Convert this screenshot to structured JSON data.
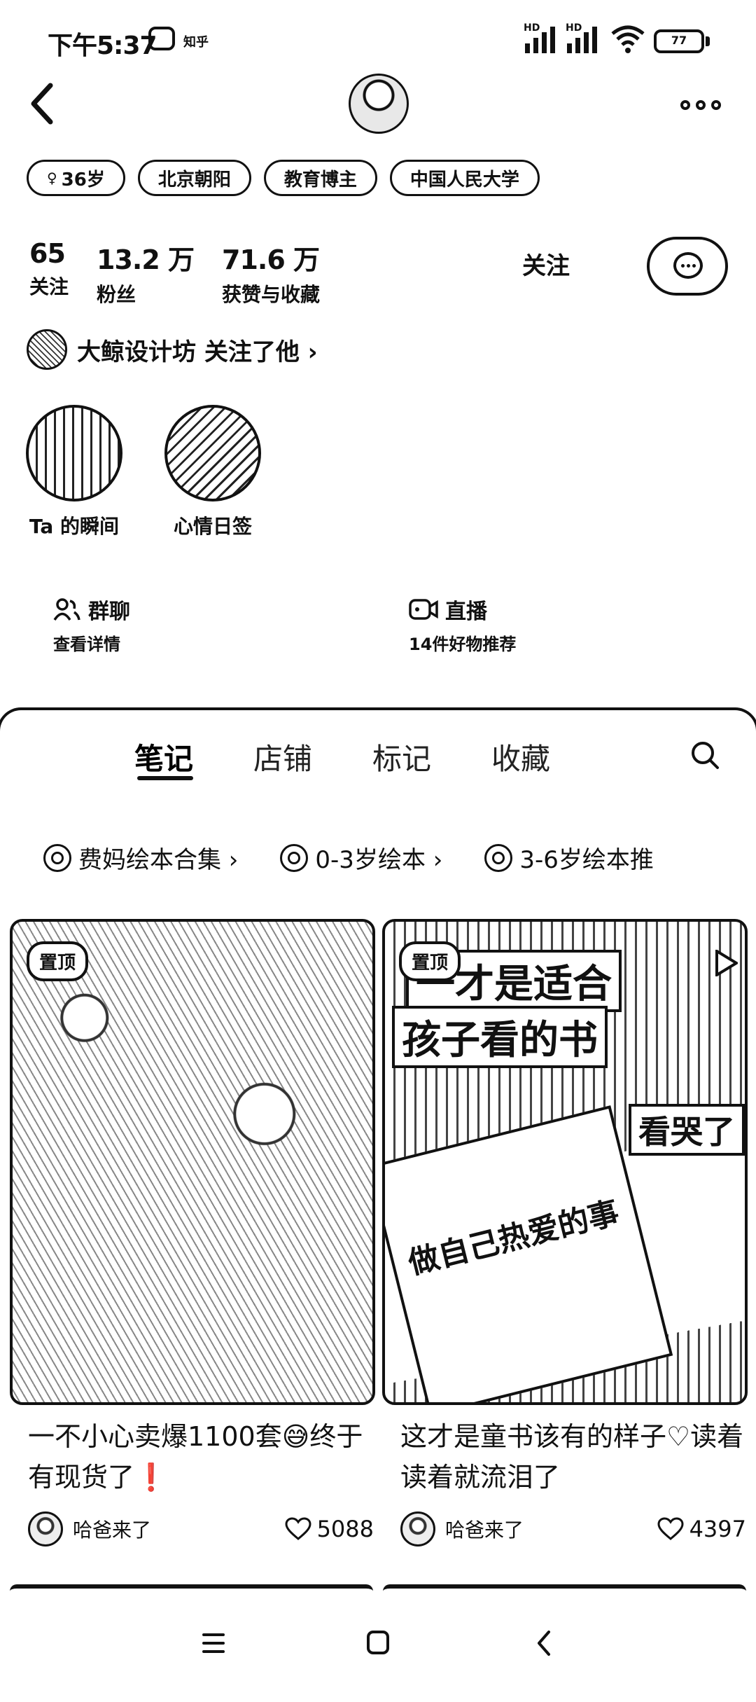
{
  "status_bar": {
    "time": "下午5:37",
    "notification_app": "知乎",
    "battery": "77"
  },
  "header": {
    "back_icon": "chevron-left-icon",
    "more_icon": "more-horizontal-icon"
  },
  "tags": [
    {
      "label": "36岁",
      "icon": "female-icon"
    },
    {
      "label": "北京朝阳"
    },
    {
      "label": "教育博主"
    },
    {
      "label": "中国人民大学"
    }
  ],
  "stats": [
    {
      "value": "65",
      "label": "关注"
    },
    {
      "value": "13.2 万",
      "label": "粉丝"
    },
    {
      "value": "71.6 万",
      "label": "获赞与收藏"
    }
  ],
  "actions": {
    "follow_label": "关注"
  },
  "followed_by": {
    "text": "大鲸设计坊 关注了他 ›"
  },
  "highlights": [
    {
      "label": "Ta 的瞬间"
    },
    {
      "label": "心情日签"
    }
  ],
  "features": [
    {
      "title": "群聊",
      "subtitle": "查看详情",
      "icon": "group-icon"
    },
    {
      "title": "直播",
      "subtitle": "14件好物推荐",
      "icon": "live-video-icon"
    }
  ],
  "tabs": [
    {
      "label": "笔记",
      "active": true
    },
    {
      "label": "店铺"
    },
    {
      "label": "标记"
    },
    {
      "label": "收藏"
    }
  ],
  "collections": [
    {
      "label": "费妈绘本合集 ›"
    },
    {
      "label": "0-3岁绘本 ›"
    },
    {
      "label": "3-6岁绘本推"
    }
  ],
  "notes": [
    {
      "pin": "置顶",
      "title": "一不小心卖爆1100套😅终于有现货了❗",
      "author": "哈爸来了",
      "likes": "5088"
    },
    {
      "pin": "置顶",
      "title": "这才是童书该有的样子♡读着读着就流泪了",
      "author": "哈爸来了",
      "likes": "4397",
      "overlay_1": "一才是适合",
      "overlay_2": "孩子看的书",
      "overlay_3": "看哭了",
      "book_title": "做自己热爱的事"
    }
  ],
  "nav": {
    "menu_icon": "menu-icon",
    "home_icon": "home-square-icon",
    "back_icon": "back-triangle-icon"
  }
}
